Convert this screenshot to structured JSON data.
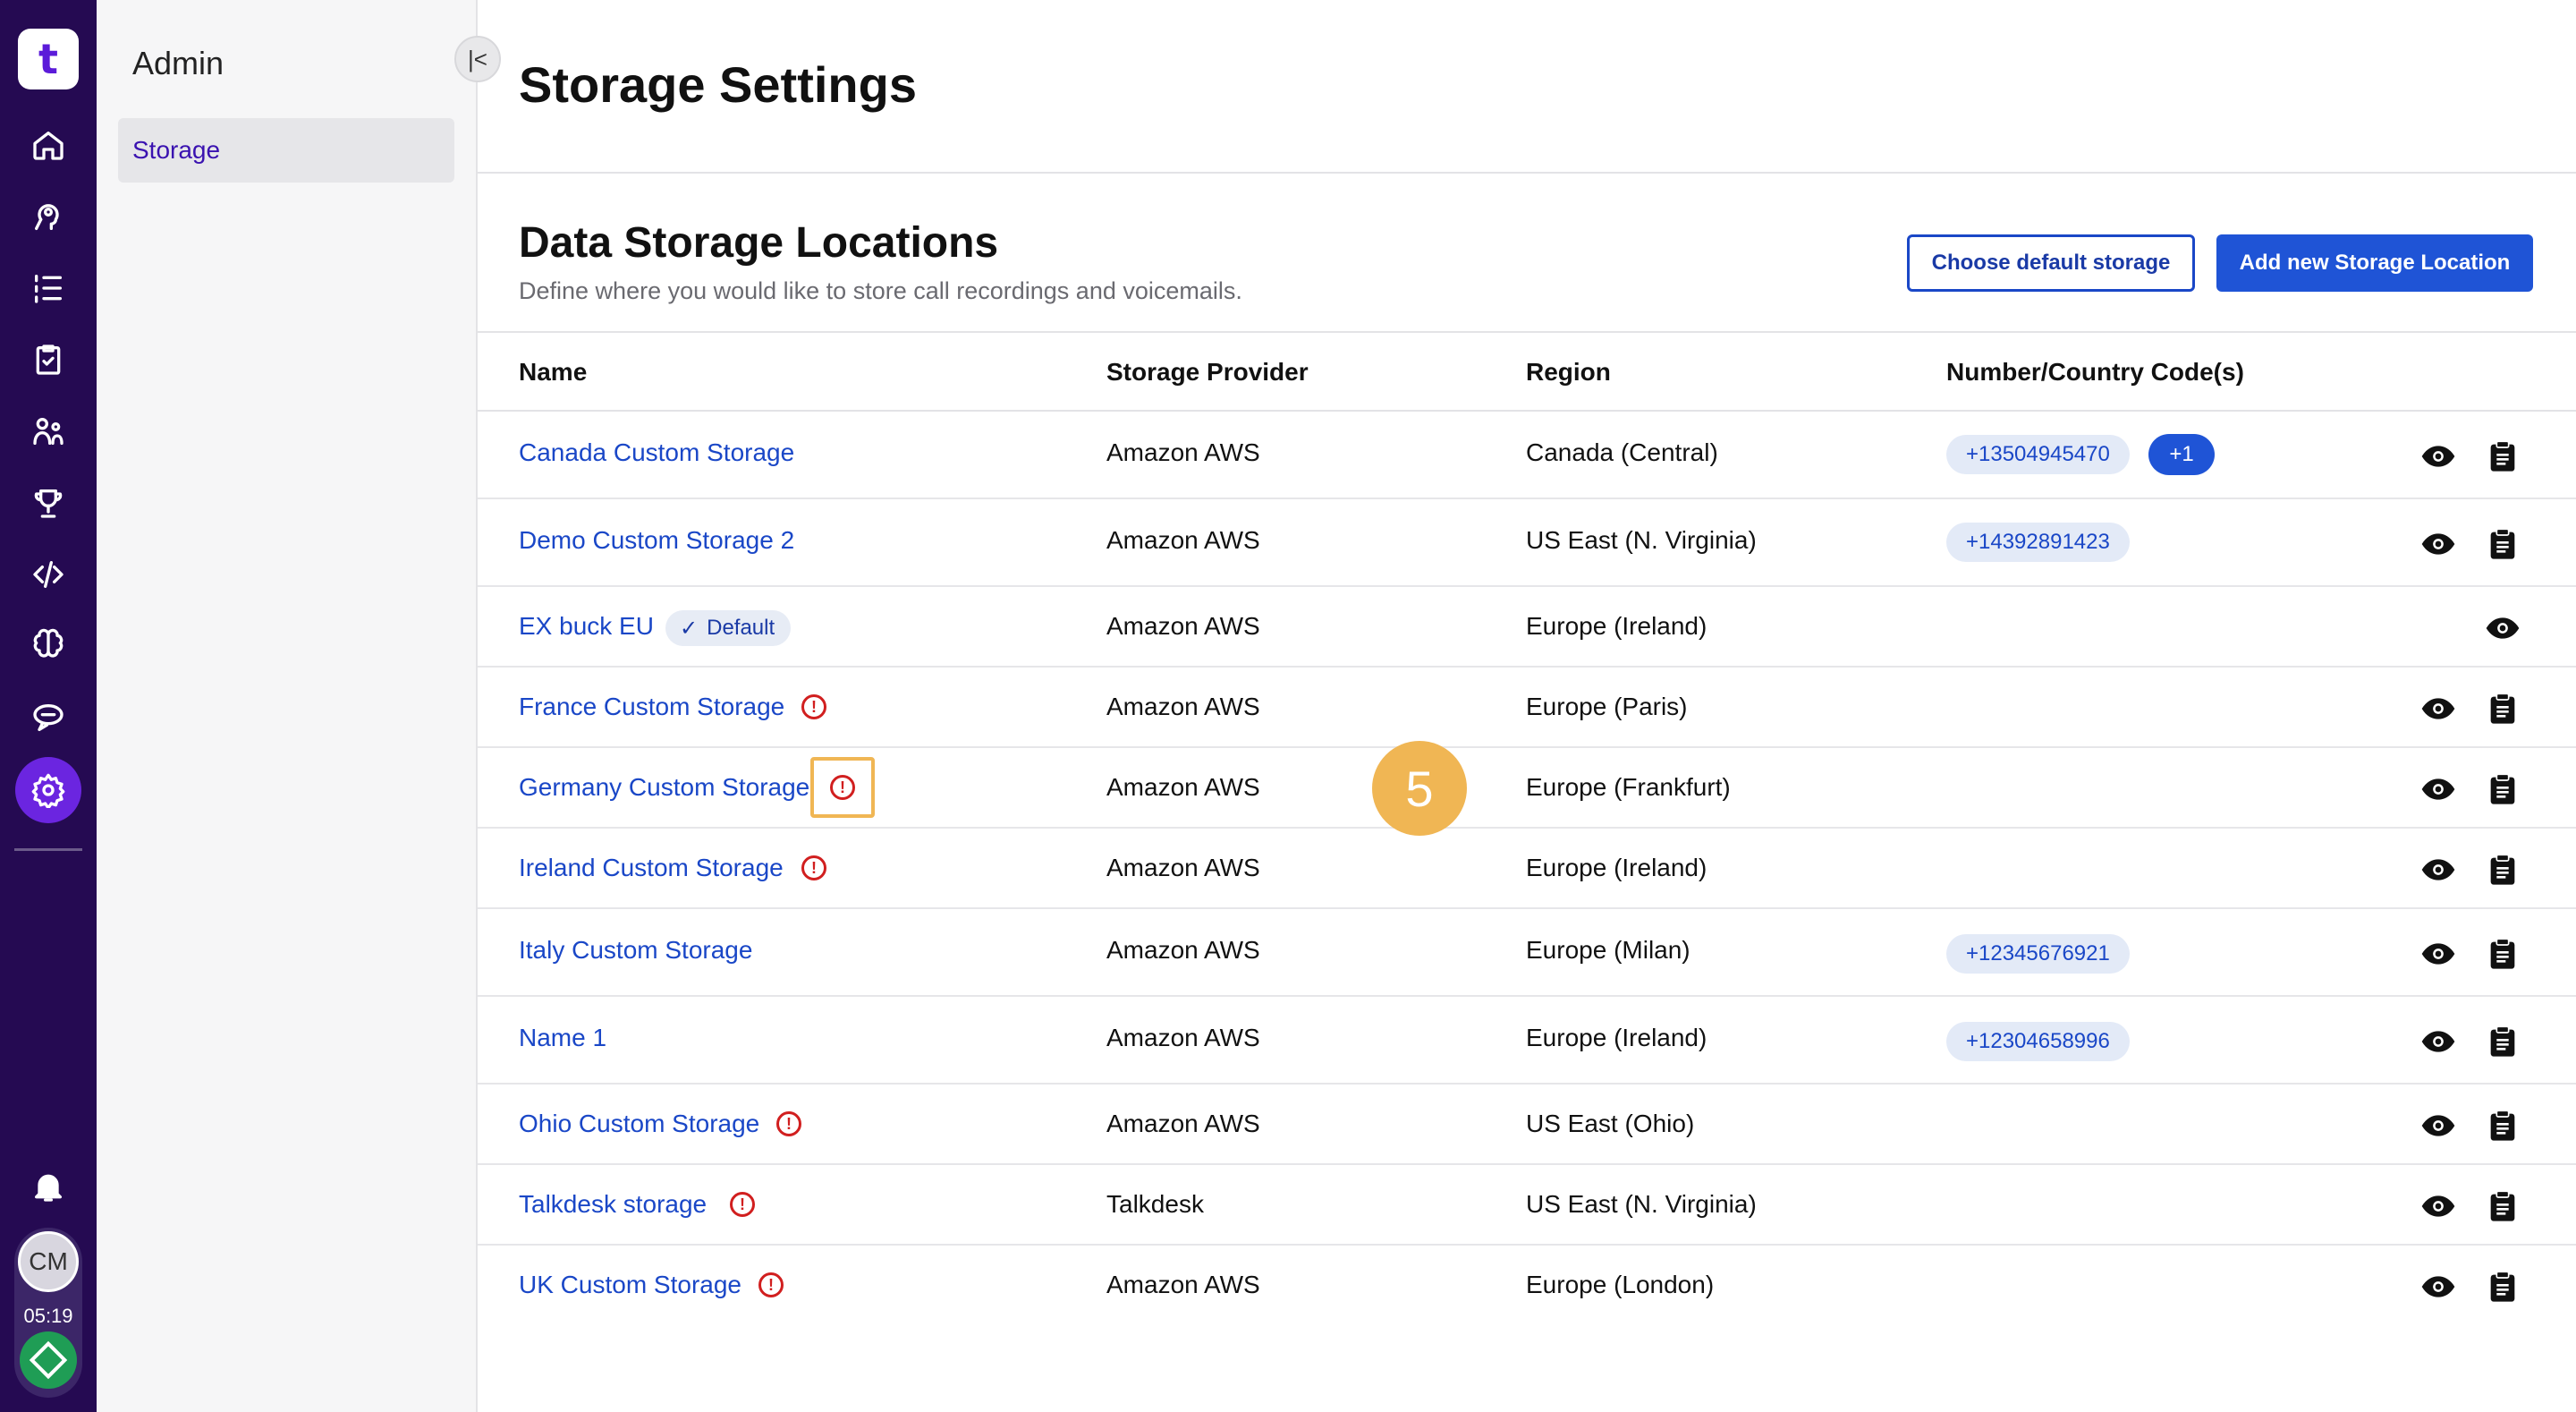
{
  "rail": {
    "logo_text": "t",
    "items": [
      "home-icon",
      "agent-icon",
      "list-icon",
      "clipboard-icon",
      "team-icon",
      "trophy-icon",
      "code-icon",
      "brain-icon",
      "chat-icon",
      "gear-icon"
    ],
    "active": "gear-icon",
    "avatar_initials": "CM",
    "time": "05:19"
  },
  "sidebar": {
    "title": "Admin",
    "items": [
      {
        "label": "Storage",
        "active": true
      }
    ]
  },
  "page": {
    "title": "Storage Settings"
  },
  "section": {
    "title": "Data Storage Locations",
    "subtitle": "Define where you would like to store call recordings and voicemails.",
    "choose_default_label": "Choose default storage",
    "add_new_label": "Add new Storage Location"
  },
  "table": {
    "headers": [
      "Name",
      "Storage Provider",
      "Region",
      "Number/Country Code(s)"
    ],
    "rows": [
      {
        "name": "Canada Custom Storage",
        "provider": "Amazon AWS",
        "region": "Canada (Central)",
        "numbers": [
          "+13504945470"
        ],
        "more": "+1",
        "warning": false,
        "default": false
      },
      {
        "name": "Demo Custom Storage 2",
        "provider": "Amazon AWS",
        "region": "US East (N. Virginia)",
        "numbers": [
          "+14392891423"
        ],
        "warning": false,
        "default": false
      },
      {
        "name": "EX buck EU",
        "provider": "Amazon AWS",
        "region": "Europe (Ireland)",
        "numbers": [],
        "warning": false,
        "default": true,
        "default_label": "Default"
      },
      {
        "name": "France Custom Storage",
        "provider": "Amazon AWS",
        "region": "Europe (Paris)",
        "numbers": [],
        "warning": true,
        "default": false
      },
      {
        "name": "Germany Custom Storage",
        "provider": "Amazon AWS",
        "region": "Europe (Frankfurt)",
        "numbers": [],
        "warning": true,
        "default": false
      },
      {
        "name": "Ireland Custom Storage",
        "provider": "Amazon AWS",
        "region": "Europe (Ireland)",
        "numbers": [],
        "warning": true,
        "default": false
      },
      {
        "name": "Italy Custom Storage",
        "provider": "Amazon AWS",
        "region": "Europe (Milan)",
        "numbers": [
          "+12345676921"
        ],
        "warning": false,
        "default": false
      },
      {
        "name": "Name 1",
        "provider": "Amazon AWS",
        "region": "Europe (Ireland)",
        "numbers": [
          "+12304658996"
        ],
        "warning": false,
        "default": false
      },
      {
        "name": "Ohio Custom Storage",
        "provider": "Amazon AWS",
        "region": "US East (Ohio)",
        "numbers": [],
        "warning": true,
        "default": false
      },
      {
        "name": "Talkdesk storage",
        "provider": "Talkdesk",
        "region": "US East (N. Virginia)",
        "numbers": [],
        "warning": true,
        "default": false
      },
      {
        "name": "UK Custom Storage",
        "provider": "Amazon AWS",
        "region": "Europe (London)",
        "numbers": [],
        "warning": true,
        "default": false
      }
    ]
  },
  "annotation": {
    "step_number": "5"
  },
  "colors": {
    "rail_bg": "#250a52",
    "active_rail": "#6b25e0",
    "link": "#1a47c7",
    "primary": "#1f54d6",
    "warning": "#d11f1f",
    "highlight": "#f0b654"
  }
}
